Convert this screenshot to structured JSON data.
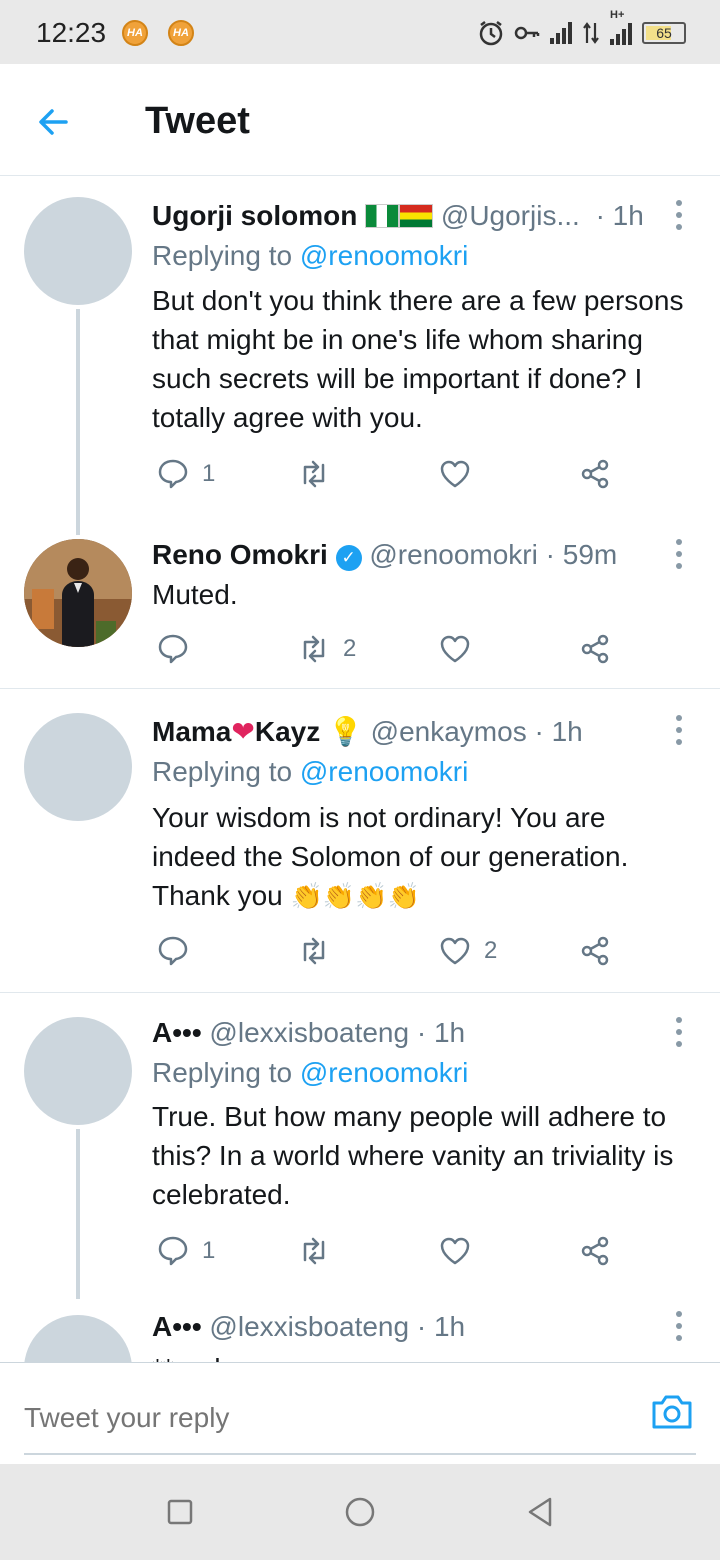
{
  "status_bar": {
    "time": "12:23",
    "app_badges": [
      "HA",
      "HA"
    ],
    "network_label": "H+",
    "battery_level": "65"
  },
  "header": {
    "title": "Tweet"
  },
  "tweets": [
    {
      "name": "Ugorji solomon",
      "handle": "@Ugorjis...",
      "time": "· 1h",
      "replying_label": "Replying to",
      "replying_to": "@renoomokri",
      "text": "But don't you think there are a few persons that might be in one's life whom sharing such secrets will be important if done? I totally agree with you.",
      "reply_count": "1",
      "retweet_count": "",
      "like_count": ""
    },
    {
      "name": "Reno Omokri",
      "handle": "@renoomokri",
      "time": "· 59m",
      "text": "Muted.",
      "reply_count": "",
      "retweet_count": "2",
      "like_count": ""
    },
    {
      "name": "Mama",
      "name_suffix": "Kayz",
      "handle": "@enkaymos",
      "time": "· 1h",
      "replying_label": "Replying to",
      "replying_to": "@renoomokri",
      "text": "Your wisdom is not ordinary! You are indeed the Solomon of our generation. Thank you",
      "reply_count": "",
      "retweet_count": "",
      "like_count": "2"
    },
    {
      "name": "A•••",
      "handle": "@lexxisboateng",
      "time": "· 1h",
      "replying_label": "Replying to",
      "replying_to": "@renoomokri",
      "text": "True. But how many people will adhere to this? In a world where vanity an triviality is celebrated.",
      "reply_count": "1",
      "retweet_count": "",
      "like_count": ""
    },
    {
      "name": "A•••",
      "handle": "@lexxisboateng",
      "time": "· 1h",
      "text": "**and"
    }
  ],
  "composer": {
    "placeholder": "Tweet your reply"
  },
  "colors": {
    "accent": "#1da1f2",
    "secondary_text": "#657786",
    "avatar_placeholder": "#ccd6dd"
  }
}
